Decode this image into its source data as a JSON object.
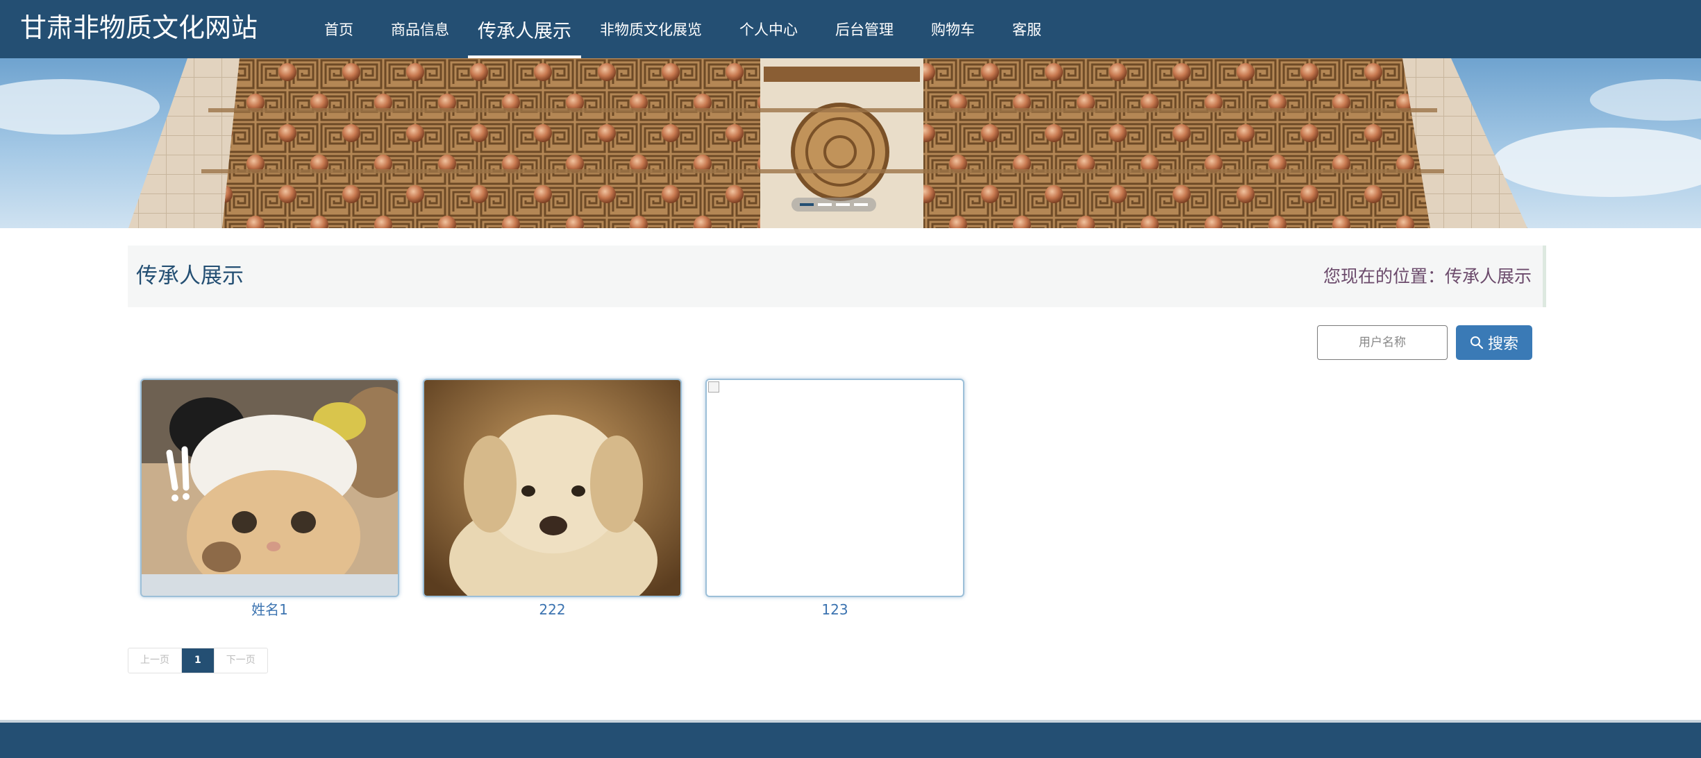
{
  "site": {
    "title": "甘肃非物质文化网站"
  },
  "nav": {
    "items": [
      {
        "label": "首页"
      },
      {
        "label": "商品信息"
      },
      {
        "label": "传承人展示"
      },
      {
        "label": "非物质文化展览"
      },
      {
        "label": "个人中心"
      },
      {
        "label": "后台管理"
      },
      {
        "label": "购物车"
      },
      {
        "label": "客服"
      }
    ],
    "active_index": 2
  },
  "banner": {
    "slide_count": 4,
    "active_slide": 1
  },
  "location_bar": {
    "title": "传承人展示",
    "breadcrumb": "您现在的位置：传承人展示"
  },
  "search": {
    "placeholder": "用户名称",
    "value": "",
    "button_label": "搜索"
  },
  "cards": [
    {
      "name": "姓名1",
      "image": "cat-in-sheep-hat-photo"
    },
    {
      "name": "222",
      "image": "fluffy-puppy-photo"
    },
    {
      "name": "123",
      "image": "broken-image"
    }
  ],
  "pagination": {
    "prev_label": "上一页",
    "current_page": "1",
    "next_label": "下一页"
  },
  "colors": {
    "header": "#244f73",
    "accent": "#3a7ab6",
    "card_name": "#3b73b0",
    "breadcrumb": "#6b4a6b"
  }
}
